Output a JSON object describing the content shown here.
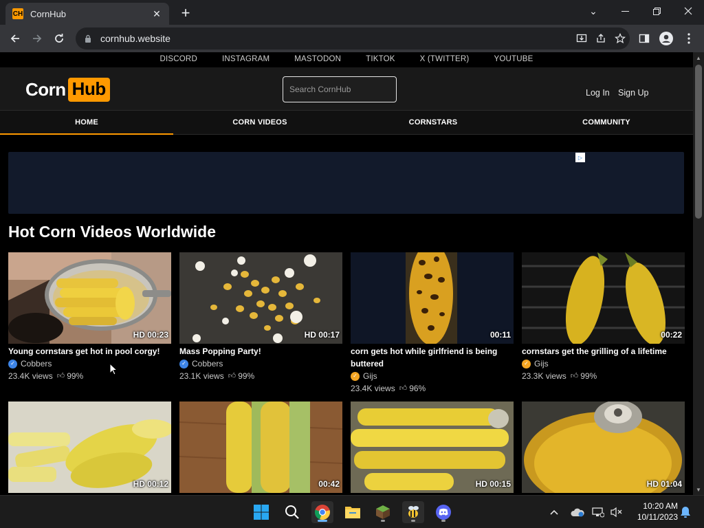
{
  "browser": {
    "tab_title": "CornHub",
    "tab_favicon": "CH",
    "url": "cornhub.website"
  },
  "social_links": [
    "DISCORD",
    "INSTAGRAM",
    "MASTODON",
    "TIKTOK",
    "X (TWITTER)",
    "YOUTUBE"
  ],
  "header": {
    "logo_part1": "Corn",
    "logo_part2": "Hub",
    "search_placeholder": "Search CornHub",
    "login": "Log In",
    "signup": "Sign Up"
  },
  "nav": [
    "HOME",
    "CORN VIDEOS",
    "CORNSTARS",
    "COMMUNITY"
  ],
  "section_title": "Hot Corn Videos Worldwide",
  "videos": [
    {
      "title": "Young cornstars get hot in pool corgy!",
      "uploader": "Cobbers",
      "badge": "blue",
      "views": "23.4K views",
      "rating": "99%",
      "duration": "HD 00:23"
    },
    {
      "title": "Mass Popping Party!",
      "uploader": "Cobbers",
      "badge": "blue",
      "views": "23.1K views",
      "rating": "99%",
      "duration": "HD 00:17"
    },
    {
      "title": "corn gets hot while girlfriend is being buttered",
      "uploader": "Gijs",
      "badge": "orange",
      "views": "23.4K views",
      "rating": "96%",
      "duration": "00:11"
    },
    {
      "title": "cornstars get the grilling of a lifetime",
      "uploader": "Gijs",
      "badge": "orange",
      "views": "23.3K views",
      "rating": "99%",
      "duration": "00:22"
    },
    {
      "duration": "HD 00:12"
    },
    {
      "duration": "00:42"
    },
    {
      "duration": "HD 00:15"
    },
    {
      "duration": "HD 01:04"
    }
  ],
  "taskbar": {
    "time": "10:20 AM",
    "date": "10/11/2023"
  },
  "colors": {
    "accent": "#ff9900",
    "page_bg": "#000000",
    "header_bg": "#191919"
  }
}
